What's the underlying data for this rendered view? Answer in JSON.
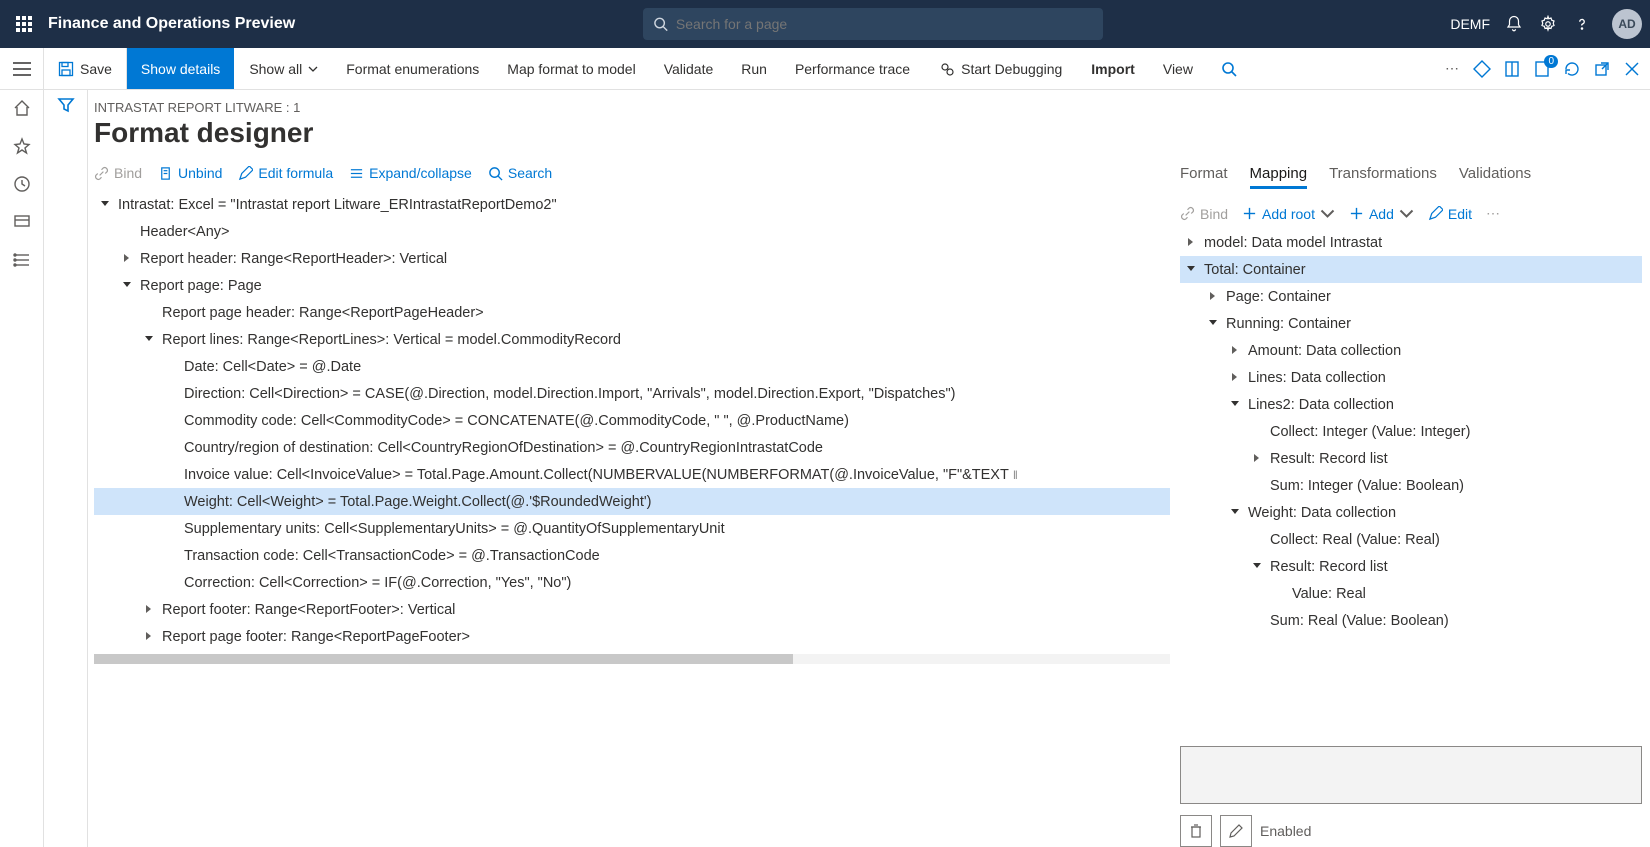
{
  "top": {
    "appTitle": "Finance and Operations Preview",
    "searchPlaceholder": "Search for a page",
    "company": "DEMF",
    "avatar": "AD"
  },
  "actionbar": {
    "save": "Save",
    "showDetails": "Show details",
    "showAll": "Show all",
    "formatEnum": "Format enumerations",
    "mapFormat": "Map format to model",
    "validate": "Validate",
    "run": "Run",
    "perf": "Performance trace",
    "startDebug": "Start Debugging",
    "import": "Import",
    "view": "View",
    "badge": "0"
  },
  "page": {
    "breadcrumb": "INTRASTAT REPORT LITWARE : 1",
    "title": "Format designer"
  },
  "leftToolbar": {
    "bind": "Bind",
    "unbind": "Unbind",
    "editFormula": "Edit formula",
    "expand": "Expand/collapse",
    "search": "Search"
  },
  "leftTree": [
    {
      "depth": 0,
      "expand": "open",
      "text": "Intrastat: Excel = \"Intrastat report Litware_ERIntrastatReportDemo2\"",
      "sel": false
    },
    {
      "depth": 1,
      "expand": "none",
      "text": "Header<Any>",
      "sel": false
    },
    {
      "depth": 1,
      "expand": "closed",
      "text": "Report header: Range<ReportHeader>: Vertical",
      "sel": false
    },
    {
      "depth": 1,
      "expand": "open",
      "text": "Report page: Page",
      "sel": false
    },
    {
      "depth": 2,
      "expand": "none",
      "text": "Report page header: Range<ReportPageHeader>",
      "sel": false
    },
    {
      "depth": 2,
      "expand": "open",
      "text": "Report lines: Range<ReportLines>: Vertical = model.CommodityRecord",
      "sel": false
    },
    {
      "depth": 3,
      "expand": "none",
      "text": "Date: Cell<Date> = @.Date",
      "sel": false
    },
    {
      "depth": 3,
      "expand": "none",
      "text": "Direction: Cell<Direction> = CASE(@.Direction, model.Direction.Import, \"Arrivals\", model.Direction.Export, \"Dispatches\")",
      "sel": false
    },
    {
      "depth": 3,
      "expand": "none",
      "text": "Commodity code: Cell<CommodityCode> = CONCATENATE(@.CommodityCode, \" \", @.ProductName)",
      "sel": false
    },
    {
      "depth": 3,
      "expand": "none",
      "text": "Country/region of destination: Cell<CountryRegionOfDestination> = @.CountryRegionIntrastatCode",
      "sel": false
    },
    {
      "depth": 3,
      "expand": "none",
      "text": "Invoice value: Cell<InvoiceValue> = Total.Page.Amount.Collect(NUMBERVALUE(NUMBERFORMAT(@.InvoiceValue, \"F\"&TEXT",
      "sel": false,
      "pin": true
    },
    {
      "depth": 3,
      "expand": "none",
      "text": "Weight: Cell<Weight> = Total.Page.Weight.Collect(@.'$RoundedWeight')",
      "sel": true
    },
    {
      "depth": 3,
      "expand": "none",
      "text": "Supplementary units: Cell<SupplementaryUnits> = @.QuantityOfSupplementaryUnit",
      "sel": false
    },
    {
      "depth": 3,
      "expand": "none",
      "text": "Transaction code: Cell<TransactionCode> = @.TransactionCode",
      "sel": false
    },
    {
      "depth": 3,
      "expand": "none",
      "text": "Correction: Cell<Correction> = IF(@.Correction, \"Yes\", \"No\")",
      "sel": false
    },
    {
      "depth": 2,
      "expand": "closed",
      "text": "Report footer: Range<ReportFooter>: Vertical",
      "sel": false
    },
    {
      "depth": 2,
      "expand": "closed",
      "text": "Report page footer: Range<ReportPageFooter>",
      "sel": false
    }
  ],
  "rightTabs": {
    "format": "Format",
    "mapping": "Mapping",
    "transformations": "Transformations",
    "validations": "Validations"
  },
  "rightToolbar": {
    "bind": "Bind",
    "addRoot": "Add root",
    "add": "Add",
    "edit": "Edit"
  },
  "rightTree": [
    {
      "depth": 0,
      "expand": "closed",
      "text": "model: Data model Intrastat",
      "sel": false
    },
    {
      "depth": 0,
      "expand": "open",
      "text": "Total: Container",
      "sel": true
    },
    {
      "depth": 1,
      "expand": "closed",
      "text": "Page: Container",
      "sel": false
    },
    {
      "depth": 1,
      "expand": "open",
      "text": "Running: Container",
      "sel": false
    },
    {
      "depth": 2,
      "expand": "closed",
      "text": "Amount: Data collection",
      "sel": false
    },
    {
      "depth": 2,
      "expand": "closed",
      "text": "Lines: Data collection",
      "sel": false
    },
    {
      "depth": 2,
      "expand": "open",
      "text": "Lines2: Data collection",
      "sel": false
    },
    {
      "depth": 3,
      "expand": "none",
      "text": "Collect: Integer (Value: Integer)",
      "sel": false
    },
    {
      "depth": 3,
      "expand": "closed",
      "text": "Result: Record list",
      "sel": false
    },
    {
      "depth": 3,
      "expand": "none",
      "text": "Sum: Integer (Value: Boolean)",
      "sel": false
    },
    {
      "depth": 2,
      "expand": "open",
      "text": "Weight: Data collection",
      "sel": false
    },
    {
      "depth": 3,
      "expand": "none",
      "text": "Collect: Real (Value: Real)",
      "sel": false
    },
    {
      "depth": 3,
      "expand": "open",
      "text": "Result: Record list",
      "sel": false
    },
    {
      "depth": 4,
      "expand": "none",
      "text": "Value: Real",
      "sel": false
    },
    {
      "depth": 3,
      "expand": "none",
      "text": "Sum: Real (Value: Boolean)",
      "sel": false
    }
  ],
  "detail": {
    "enabledLabel": "Enabled"
  }
}
